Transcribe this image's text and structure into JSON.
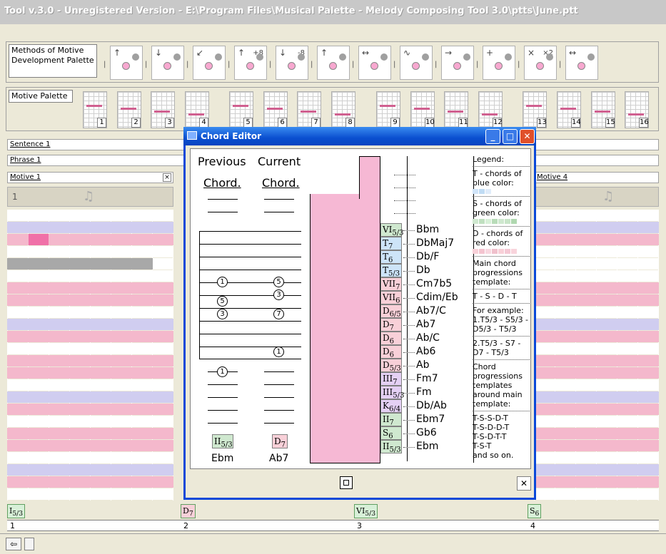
{
  "window": {
    "title": "Tool v.3.0 - Unregistered Version - E:\\Program Files\\Musical Palette - Melody Composing Tool 3.0\\ptts\\June.ptt"
  },
  "methods_palette": {
    "label": "Methods of Motive Development Palette",
    "buttons": [
      "",
      "",
      "",
      "+8",
      "-8",
      "",
      "",
      "",
      "",
      "",
      "×2",
      ""
    ]
  },
  "motive_palette": {
    "label": "Motive Palette",
    "tiles": [
      "1",
      "2",
      "3",
      "4",
      "5",
      "6",
      "7",
      "8",
      "9",
      "10",
      "11",
      "12",
      "13",
      "14",
      "15",
      "16"
    ]
  },
  "structure": {
    "sentence": "Sentence 1",
    "phrase": "Phrase 1",
    "motive_left": "Motive 1",
    "motive_right": "Motive 4",
    "bar_number_left": "1"
  },
  "timeline": {
    "chords": [
      {
        "root": "I",
        "sub": "5/3"
      },
      {
        "root": "D",
        "sub": "7"
      },
      {
        "root": "VI",
        "sub": "5/3"
      },
      {
        "root": "S",
        "sub": "6"
      }
    ],
    "measures": [
      "1",
      "2",
      "3",
      "4"
    ]
  },
  "dialog": {
    "title": "Chord Editor",
    "previous": {
      "header1": "Previous",
      "header2": "Chord.",
      "circles": [
        "1",
        "5",
        "3"
      ],
      "below_circle": "1",
      "chord_root": "II",
      "chord_sub": "5/3",
      "chord_name": "Ebm"
    },
    "current": {
      "header1": "Current",
      "header2": "Chord.",
      "circles": [
        "5",
        "3",
        "7",
        "1"
      ],
      "chord_root": "D",
      "chord_sub": "7",
      "chord_name": "Ab7"
    },
    "chord_list": [
      {
        "func": "S",
        "deg": "VI",
        "sub": "5/3",
        "name": "Bbm"
      },
      {
        "func": "T",
        "deg": "T",
        "sub": "7",
        "name": "DbMaj7"
      },
      {
        "func": "T",
        "deg": "T",
        "sub": "6",
        "name": "Db/F"
      },
      {
        "func": "T",
        "deg": "T",
        "sub": "5/3",
        "name": "Db"
      },
      {
        "func": "D",
        "deg": "VII",
        "sub": "7",
        "name": "Cm7b5"
      },
      {
        "func": "D",
        "deg": "VII",
        "sub": "6",
        "name": "Cdim/Eb"
      },
      {
        "func": "D",
        "deg": "D",
        "sub": "6/5",
        "name": "Ab7/C"
      },
      {
        "func": "D",
        "deg": "D",
        "sub": "7",
        "name": "Ab7"
      },
      {
        "func": "D",
        "deg": "D",
        "sub": "6",
        "name": "Ab/C"
      },
      {
        "func": "D",
        "deg": "D",
        "sub": "6",
        "name": "Ab6"
      },
      {
        "func": "D",
        "deg": "D",
        "sub": "5/3",
        "name": "Ab"
      },
      {
        "func": "K",
        "deg": "III",
        "sub": "7",
        "name": "Fm7"
      },
      {
        "func": "K",
        "deg": "III",
        "sub": "5/3",
        "name": "Fm"
      },
      {
        "func": "K",
        "deg": "K",
        "sub": "6/4",
        "name": "Db/Ab"
      },
      {
        "func": "S",
        "deg": "II",
        "sub": "7",
        "name": "Ebm7"
      },
      {
        "func": "S",
        "deg": "S",
        "sub": "6",
        "name": "Gb6"
      },
      {
        "func": "S",
        "deg": "II",
        "sub": "5/3",
        "name": "Ebm"
      }
    ],
    "legend": {
      "title": "Legend:",
      "t_text": "T - chords of blue color:",
      "s_text": "S - chords of green color:",
      "d_text": "D - chords of red color:",
      "main_text": "Main chord progressions template:",
      "main_template": "T - S - D - T",
      "example_text": "For example:",
      "example1": "1.T5/3 - S5/3 - D5/3 - T5/3",
      "example2": "2.T5/3 - S7 - D7 - T5/3",
      "around_text": "Chord progressions templates around main template:",
      "templates": [
        "T-S-S-D-T",
        "T-S-D-D-T",
        "T-S-D-T-T",
        "T-S-T"
      ],
      "and_so_on": "and so on."
    }
  },
  "colors": {
    "titlebar_accent": "#0a48d8",
    "tonic": "#cde4f8",
    "subdominant": "#cfe8cf",
    "dominant": "#f8d0d8"
  }
}
